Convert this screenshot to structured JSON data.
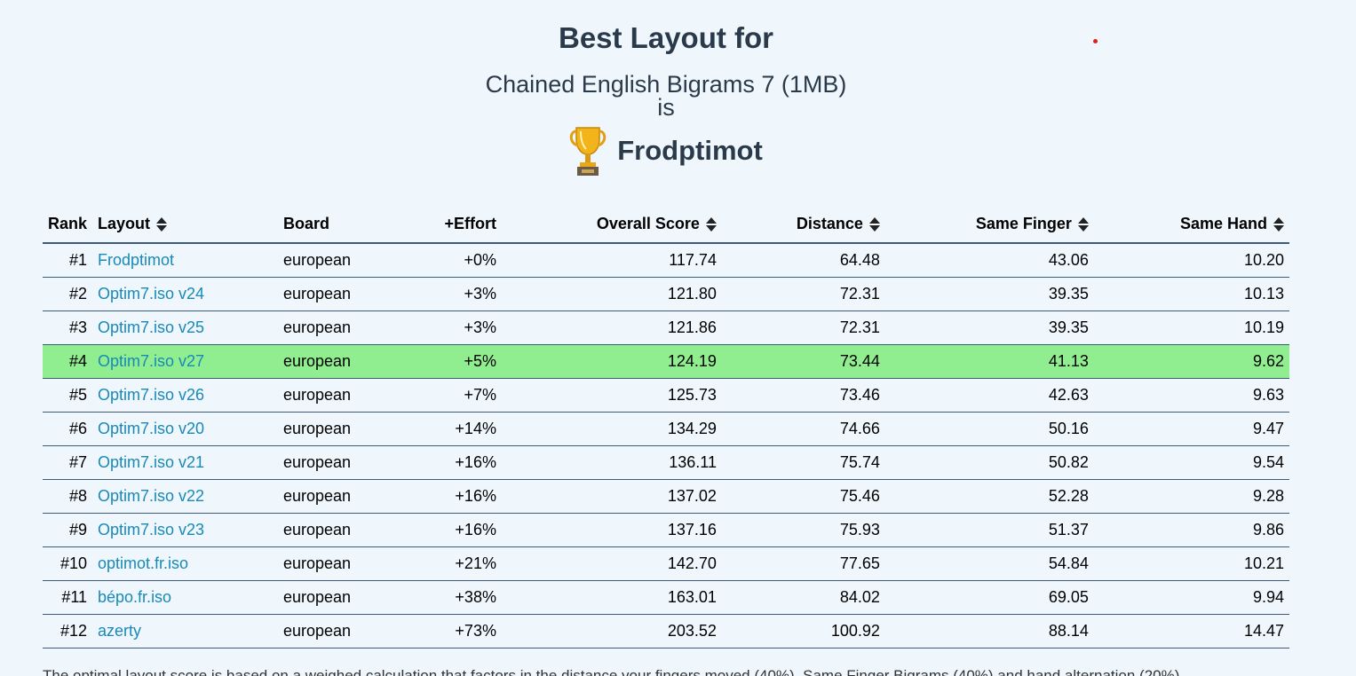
{
  "header": {
    "title": "Best Layout for",
    "corpus": "Chained English Bigrams 7 (1MB)",
    "is": "is",
    "winner": "Frodptimot",
    "trophy_icon": "trophy-icon"
  },
  "table": {
    "columns": {
      "rank": "Rank",
      "layout": "Layout",
      "board": "Board",
      "effort": "+Effort",
      "overall": "Overall Score",
      "distance": "Distance",
      "same_finger": "Same Finger",
      "same_hand": "Same Hand"
    },
    "rows": [
      {
        "rank": "#1",
        "layout": "Frodptimot",
        "board": "european",
        "effort": "+0%",
        "overall": "117.74",
        "distance": "64.48",
        "same_finger": "43.06",
        "same_hand": "10.20"
      },
      {
        "rank": "#2",
        "layout": "Optim7.iso v24",
        "board": "european",
        "effort": "+3%",
        "overall": "121.80",
        "distance": "72.31",
        "same_finger": "39.35",
        "same_hand": "10.13"
      },
      {
        "rank": "#3",
        "layout": "Optim7.iso v25",
        "board": "european",
        "effort": "+3%",
        "overall": "121.86",
        "distance": "72.31",
        "same_finger": "39.35",
        "same_hand": "10.19"
      },
      {
        "rank": "#4",
        "layout": "Optim7.iso v27",
        "board": "european",
        "effort": "+5%",
        "overall": "124.19",
        "distance": "73.44",
        "same_finger": "41.13",
        "same_hand": "9.62"
      },
      {
        "rank": "#5",
        "layout": "Optim7.iso v26",
        "board": "european",
        "effort": "+7%",
        "overall": "125.73",
        "distance": "73.46",
        "same_finger": "42.63",
        "same_hand": "9.63"
      },
      {
        "rank": "#6",
        "layout": "Optim7.iso v20",
        "board": "european",
        "effort": "+14%",
        "overall": "134.29",
        "distance": "74.66",
        "same_finger": "50.16",
        "same_hand": "9.47"
      },
      {
        "rank": "#7",
        "layout": "Optim7.iso v21",
        "board": "european",
        "effort": "+16%",
        "overall": "136.11",
        "distance": "75.74",
        "same_finger": "50.82",
        "same_hand": "9.54"
      },
      {
        "rank": "#8",
        "layout": "Optim7.iso v22",
        "board": "european",
        "effort": "+16%",
        "overall": "137.02",
        "distance": "75.46",
        "same_finger": "52.28",
        "same_hand": "9.28"
      },
      {
        "rank": "#9",
        "layout": "Optim7.iso v23",
        "board": "european",
        "effort": "+16%",
        "overall": "137.16",
        "distance": "75.93",
        "same_finger": "51.37",
        "same_hand": "9.86"
      },
      {
        "rank": "#10",
        "layout": "optimot.fr.iso",
        "board": "european",
        "effort": "+21%",
        "overall": "142.70",
        "distance": "77.65",
        "same_finger": "54.84",
        "same_hand": "10.21"
      },
      {
        "rank": "#11",
        "layout": "bépo.fr.iso",
        "board": "european",
        "effort": "+38%",
        "overall": "163.01",
        "distance": "84.02",
        "same_finger": "69.05",
        "same_hand": "9.94"
      },
      {
        "rank": "#12",
        "layout": "azerty",
        "board": "european",
        "effort": "+73%",
        "overall": "203.52",
        "distance": "100.92",
        "same_finger": "88.14",
        "same_hand": "14.47"
      }
    ],
    "highlighted_rank": "#4",
    "highlight_color": "#90ee90",
    "link_color": "#1889b8"
  },
  "footer": {
    "text": "The optimal layout score is based on a weighed calculation that factors in the distance your fingers moved (40%), Same Finger Bigrams (40%) and hand alternation (20%)."
  }
}
